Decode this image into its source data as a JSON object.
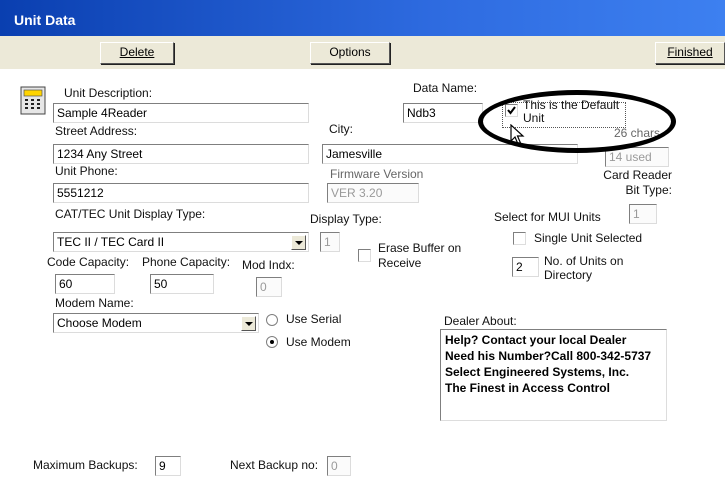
{
  "window": {
    "title": "Unit Data"
  },
  "toolbar": {
    "delete_label": "Delete",
    "options_label": "Options",
    "finished_label": "Finished"
  },
  "form": {
    "unit_description": {
      "label": "Unit Description:",
      "value": "Sample 4Reader"
    },
    "data_name": {
      "label": "Data Name:",
      "value": "Ndb3"
    },
    "default_unit": {
      "label": "This is the Default Unit",
      "checked": true
    },
    "street_address": {
      "label": "Street Address:",
      "value": "1234 Any Street"
    },
    "city": {
      "label": "City:",
      "value": "Jamesville"
    },
    "chars": {
      "label": "26 chars",
      "used": "14 used"
    },
    "unit_phone": {
      "label": "Unit Phone:",
      "value": "5551212"
    },
    "firmware": {
      "label": "Firmware Version",
      "value": "VER 3.20"
    },
    "card_reader": {
      "label": "Card Reader Bit Type:",
      "value": ""
    },
    "cat_tec_type": {
      "label": "CAT/TEC Unit Display Type:",
      "value": "TEC II / TEC Card II"
    },
    "display_type": {
      "label": "Display Type:",
      "value": "1"
    },
    "mui": {
      "label": "Select for MUI Units",
      "value": "1"
    },
    "single_unit": {
      "label": "Single Unit Selected",
      "checked": false
    },
    "erase_buffer": {
      "label_line1": "Erase Buffer on",
      "label_line2": "Receive",
      "checked": false
    },
    "units_on_directory": {
      "value": "2",
      "label_line1": "No. of Units on",
      "label_line2": "Directory"
    },
    "code_capacity": {
      "label": "Code Capacity:",
      "value": "60"
    },
    "phone_capacity": {
      "label": "Phone Capacity:",
      "value": "50"
    },
    "mod_indx": {
      "label": "Mod Indx:",
      "value": "0"
    },
    "modem_name": {
      "label": "Modem Name:",
      "value": "Choose Modem"
    },
    "use_serial": {
      "label": "Use Serial",
      "selected": false
    },
    "use_modem": {
      "label": "Use Modem",
      "selected": true
    },
    "dealer_about": {
      "label": "Dealer About:",
      "lines": [
        "Help? Contact  your local Dealer",
        "Need his Number?Call 800-342-5737",
        "Select Engineered Systems, Inc.",
        "The Finest in Access Control"
      ]
    },
    "max_backups": {
      "label": "Maximum Backups:",
      "value": "9"
    },
    "next_backup": {
      "label": "Next Backup no:",
      "value": "0"
    }
  },
  "colors": {
    "title_bar": "#0a3fb0",
    "toolbar_bg": "#ece9d8",
    "annotation": "#000000"
  },
  "icons": [
    "unit-panel-icon",
    "mouse-pointer-icon",
    "dropdown-arrow-icon"
  ]
}
